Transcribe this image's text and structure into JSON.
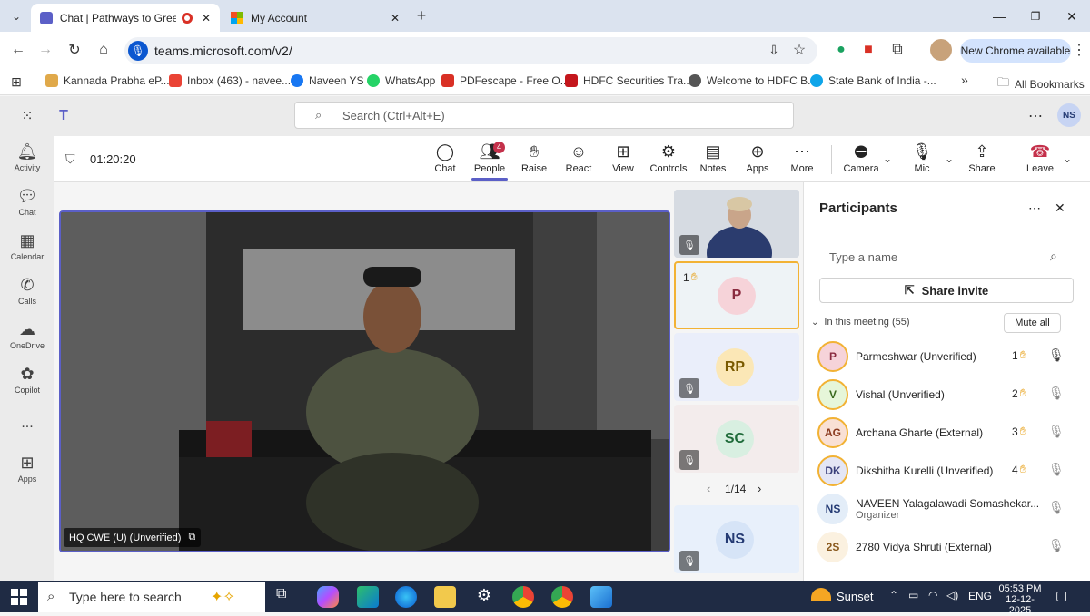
{
  "browser": {
    "tabs": [
      {
        "title": "Chat | Pathways to Green C"
      },
      {
        "title": "My Account"
      }
    ],
    "url": "teams.microsoft.com/v2/",
    "new_chrome_label": "New Chrome available",
    "bookmarks": [
      "Kannada Prabha eP...",
      "Inbox (463) - navee...",
      "Naveen YS",
      "WhatsApp",
      "PDFescape - Free O...",
      "HDFC Securities Tra...",
      "Welcome to HDFC B...",
      "State Bank of India -..."
    ],
    "all_bookmarks": "All Bookmarks"
  },
  "teams": {
    "search_placeholder": "Search (Ctrl+Alt+E)",
    "user_initials": "NS",
    "rail": [
      {
        "label": "Activity",
        "icon": "bell-icon"
      },
      {
        "label": "Chat",
        "icon": "chat-icon"
      },
      {
        "label": "Calendar",
        "icon": "calendar-icon"
      },
      {
        "label": "Calls",
        "icon": "phone-icon"
      },
      {
        "label": "OneDrive",
        "icon": "cloud-icon"
      },
      {
        "label": "Copilot",
        "icon": "copilot-icon"
      },
      {
        "label": "...",
        "icon": "more-icon"
      },
      {
        "label": "Apps",
        "icon": "apps-icon"
      }
    ]
  },
  "meeting": {
    "timer": "01:20:20",
    "toolbar": [
      {
        "label": "Chat",
        "icon": "chat-bubble-icon"
      },
      {
        "label": "People",
        "icon": "people-icon",
        "badge": "4"
      },
      {
        "label": "Raise",
        "icon": "hand-icon"
      },
      {
        "label": "React",
        "icon": "smile-icon"
      },
      {
        "label": "View",
        "icon": "grid-icon"
      },
      {
        "label": "Controls",
        "icon": "controls-icon"
      },
      {
        "label": "Notes",
        "icon": "notes-icon"
      },
      {
        "label": "Apps",
        "icon": "apps-plus-icon"
      },
      {
        "label": "More",
        "icon": "more-icon"
      }
    ],
    "camera_label": "Camera",
    "mic_label": "Mic",
    "share_label": "Share",
    "leave_label": "Leave",
    "main_speaker": "HQ CWE (U) (Unverified)",
    "tiles": [
      {
        "initials": "P",
        "hand": "1"
      },
      {
        "initials": "RP"
      },
      {
        "initials": "SC"
      },
      {
        "initials": "NS"
      }
    ],
    "pager": "1/14"
  },
  "participants": {
    "title": "Participants",
    "search_placeholder": "Type a name",
    "share_invite": "Share invite",
    "in_meeting": "In this meeting (55)",
    "mute_all": "Mute all",
    "list": [
      {
        "initials": "P",
        "name": "Parmeshwar (Unverified)",
        "hand": "1",
        "sub": ""
      },
      {
        "initials": "V",
        "name": "Vishal (Unverified)",
        "hand": "2",
        "sub": ""
      },
      {
        "initials": "AG",
        "name": "Archana Gharte (External)",
        "hand": "3",
        "sub": ""
      },
      {
        "initials": "DK",
        "name": "Dikshitha Kurelli (Unverified)",
        "hand": "4",
        "sub": ""
      },
      {
        "initials": "NS",
        "name": "NAVEEN Yalagalawadi Somashekar...",
        "hand": "",
        "sub": "Organizer"
      },
      {
        "initials": "2S",
        "name": "2780 Vidya Shruti (External)",
        "hand": "",
        "sub": ""
      }
    ]
  },
  "taskbar": {
    "search_placeholder": "Type here to search",
    "weather": "Sunset",
    "lang": "ENG",
    "time": "05:53 PM",
    "date": "12-12-2025"
  }
}
